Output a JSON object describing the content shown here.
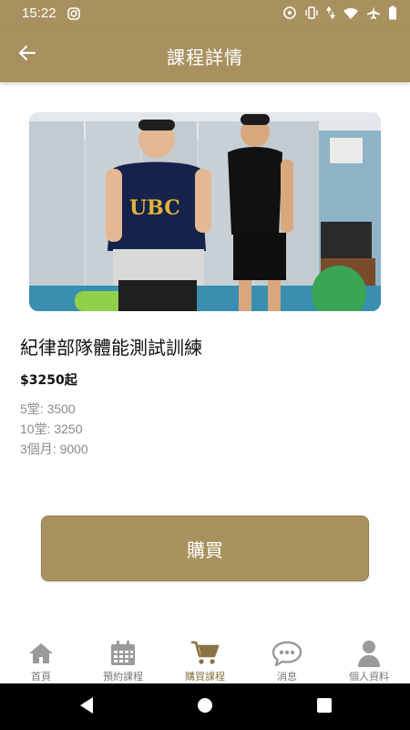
{
  "status_bar": {
    "time": "15:22",
    "icons": [
      "instagram-icon",
      "sync-icon",
      "vibrate-icon",
      "data-arrows-icon",
      "wifi-icon",
      "airplane-icon",
      "battery-icon"
    ]
  },
  "app_bar": {
    "back_icon": "arrow-left-icon",
    "title": "課程詳情"
  },
  "course": {
    "image_desc_icon": "course-photo",
    "title": "紀律部隊體能測試訓練",
    "price": "$3250起",
    "price_options": [
      "5堂: 3500",
      "10堂: 3250",
      "3個月: 9000"
    ]
  },
  "buy_button": {
    "label": "購買"
  },
  "bottom_nav": {
    "items": [
      {
        "label": "首頁",
        "icon": "home-icon",
        "active": false
      },
      {
        "label": "預約課程",
        "icon": "calendar-icon",
        "active": false
      },
      {
        "label": "購買課程",
        "icon": "cart-icon",
        "active": true
      },
      {
        "label": "消息",
        "icon": "chat-bubble-icon",
        "active": false
      },
      {
        "label": "個人資料",
        "icon": "person-icon",
        "active": false
      }
    ]
  },
  "colors": {
    "brand": "#a8915f",
    "nav_inactive_icon": "#9a9a9a",
    "nav_active_icon": "#8a7443"
  }
}
